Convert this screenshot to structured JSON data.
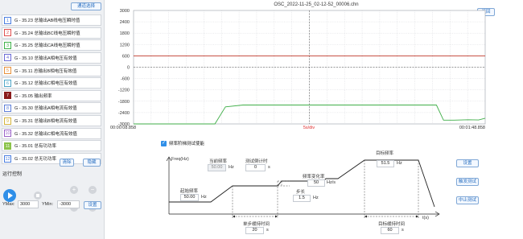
{
  "left_panel": {
    "channel_select_label": "通道选择",
    "channels": [
      {
        "num": "1",
        "text": "G - 35.23 总输出AB线电压瞬时值",
        "color": "#4a7ee0"
      },
      {
        "num": "2",
        "text": "G - 35.24 总输出BC线电压瞬时值",
        "color": "#e05050"
      },
      {
        "num": "3",
        "text": "G - 35.25 总输出CA线电压瞬时值",
        "color": "#3fb24a"
      },
      {
        "num": "4",
        "text": "G - 35.10 总输出A相电压有效值",
        "color": "#6b6bd6"
      },
      {
        "num": "5",
        "text": "G - 35.11 总输出B相电压有效值",
        "color": "#e8913a"
      },
      {
        "num": "6",
        "text": "G - 35.12 总输出C相电压有效值",
        "color": "#4fa6c8"
      },
      {
        "num": "7",
        "text": "G - 35.05 输出频率",
        "color": "#8a1c1c",
        "filled": true
      },
      {
        "num": "8",
        "text": "G - 35.30 总输出A相电流有效值",
        "color": "#5c7ed8"
      },
      {
        "num": "9",
        "text": "G - 35.31 总输出B相电流有效值",
        "color": "#d4b33a"
      },
      {
        "num": "10",
        "text": "G - 35.32 总输出C相电流有效值",
        "color": "#9a62c8"
      },
      {
        "num": "11",
        "text": "G - 35.01 总有功功率",
        "color": "#8bc34a",
        "filled": true
      },
      {
        "num": "12",
        "text": "G - 35.02 总无功功率",
        "color": "#4a7ee0"
      }
    ],
    "clear_label": "清除",
    "hide_label": "隐藏",
    "run_control_label": "运行控制",
    "ymax_label": "YMax:",
    "ymax_value": "3000",
    "ymin_label": "YMin:",
    "ymin_value": "-3000",
    "set_label": "设置"
  },
  "main": {
    "title": "OSC_2022-11-25_02-12-52_00006.chn",
    "return_label": "返回"
  },
  "chart_data": {
    "type": "line",
    "yticks": [
      "3000",
      "2400",
      "1800",
      "1200",
      "600",
      "0",
      "-600",
      "-1200",
      "-1800",
      "-2400",
      "-3000"
    ],
    "ylim": [
      -3000,
      3000
    ],
    "x_start_label": "00:00:08.858",
    "x_end_label": "00:01:48.858",
    "x_unit_label": "5s/div",
    "grid": true,
    "series": [
      {
        "color": "#c0392b",
        "x": [
          8.858,
          108.858
        ],
        "y": [
          600,
          600
        ]
      },
      {
        "color": "#3fae48",
        "x": [
          8.858,
          32.0,
          35.0,
          40.0,
          90.0,
          95.0,
          97.0,
          100.0,
          104.0,
          107.0,
          108.858
        ],
        "y": [
          -3000,
          -3000,
          -2100,
          -2000,
          -2000,
          -2000,
          -2800,
          -2800,
          -2780,
          -2790,
          -2700
        ]
      }
    ]
  },
  "freq_panel": {
    "enable_label": "频率阶梯测试使能",
    "axis_y_label": "Freq(Hz)",
    "axis_x_label": "t(s)",
    "current_freq_label": "当前频率",
    "current_freq_value": "50.00",
    "hz": "Hz",
    "test_time_label": "测试倒计时",
    "test_time_value": "0",
    "s": "s",
    "start_freq_label": "起始频率",
    "start_freq_value": "50.00",
    "freq_rate_label": "频率变化率",
    "freq_rate_value": "50",
    "rate_unit": "Hz/s",
    "step_label": "步长",
    "step_value": "1.5",
    "target_freq_label": "目标频率",
    "target_freq_value": "51.5",
    "single_step_time_label": "单步缓持时间",
    "single_step_time_value": "20",
    "target_hold_label": "目标缓持时间",
    "target_hold_value": "60",
    "settings_label": "设置",
    "trigger_label": "触发测试",
    "stop_label": "中止测试"
  }
}
